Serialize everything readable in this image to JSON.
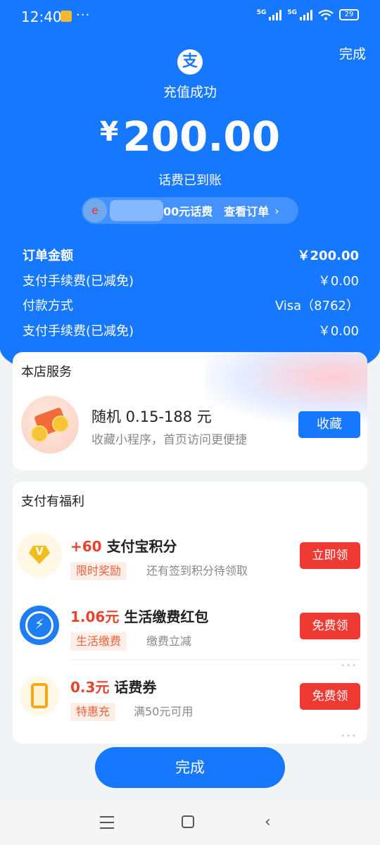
{
  "status_bar": {
    "time": "12:40",
    "dots": "···",
    "net1": "5G",
    "net2": "5G",
    "battery": "29"
  },
  "header": {
    "done_label": "完成",
    "logo_glyph": "支",
    "success_text": "充值成功",
    "currency": "¥",
    "amount": "200.00",
    "arrived_text": "话费已到账",
    "order_item_text": "00元话费",
    "view_order_label": "查看订单",
    "arrow": "›"
  },
  "details": [
    {
      "label": "订单金额",
      "value": "￥200.00"
    },
    {
      "label": "支付手续费(已减免)",
      "value": "￥0.00"
    },
    {
      "label": "付款方式",
      "value": "Visa（8762）"
    },
    {
      "label": "支付手续费(已减免)",
      "value": "￥0.00"
    }
  ],
  "store_service": {
    "title": "本店服务",
    "main_text": "随机 0.15-188 元",
    "sub_text": "收藏小程序，首页访问更便捷",
    "button_label": "收藏"
  },
  "perks": {
    "title": "支付有福利",
    "items": [
      {
        "value": "+60",
        "title": "支付宝积分",
        "tag": "限时奖励",
        "note": "还有签到积分待领取",
        "button": "立即领",
        "icon": "points-badge-icon"
      },
      {
        "value": "1.06元",
        "title": "生活缴费红包",
        "tag": "生活缴费",
        "note": "缴费立减",
        "button": "免费领",
        "icon": "bolt-icon"
      },
      {
        "value": "0.3元",
        "title": "话费券",
        "tag": "特惠充",
        "note": "满50元可用",
        "button": "免费领",
        "icon": "phone-icon"
      }
    ]
  },
  "footer": {
    "done_label": "完成"
  },
  "colors": {
    "brand_blue": "#1677ff",
    "accent_red": "#ee3a33",
    "tag_orange": "#e8623a"
  }
}
